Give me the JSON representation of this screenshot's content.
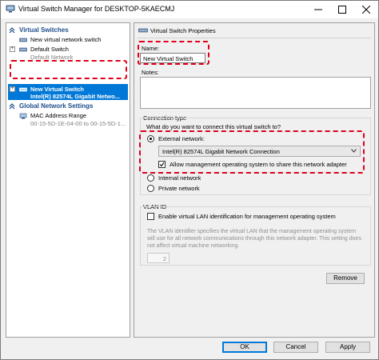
{
  "window": {
    "title": "Virtual Switch Manager for DESKTOP-5KAECMJ"
  },
  "tree": {
    "virtual_switches_header": "Virtual Switches",
    "new_switch_item": "New virtual network switch",
    "default_switch": {
      "label": "Default Switch",
      "sub": "Default Network"
    },
    "new_virtual_switch": {
      "label": "New Virtual Switch",
      "sub": "Intel(R) 82574L Gigabit Netwo..."
    },
    "global_header": "Global Network Settings",
    "mac_range": {
      "label": "MAC Address Range",
      "sub": "00-15-5D-1E-04-00 to 00-15-5D-1..."
    }
  },
  "properties": {
    "header": "Virtual Switch Properties",
    "name_label": "Name:",
    "name_value": "New Virtual Switch",
    "notes_label": "Notes:",
    "connection_type_label": "Connection type",
    "connection_question": "What do you want to connect this virtual switch to?",
    "external_network_label": "External network:",
    "adapter_selected": "Intel(R) 82574L Gigabit Network Connection",
    "allow_mgmt_label": "Allow management operating system to share this network adapter",
    "internal_network_label": "Internal network",
    "private_network_label": "Private network",
    "vlan_header": "VLAN ID",
    "vlan_enable_label": "Enable virtual LAN identification for management operating system",
    "vlan_description": "The VLAN identifier specifies the virtual LAN that the management operating system will use for all network communications through this network adapter. This setting does not affect virtual machine networking.",
    "vlan_value": "2",
    "remove_label": "Remove"
  },
  "footer": {
    "ok_label": "OK",
    "cancel_label": "Cancel",
    "apply_label": "Apply"
  },
  "colors": {
    "accent": "#0078d7",
    "highlight_dash": "#e0001a",
    "section_header": "#1e4e8c"
  }
}
